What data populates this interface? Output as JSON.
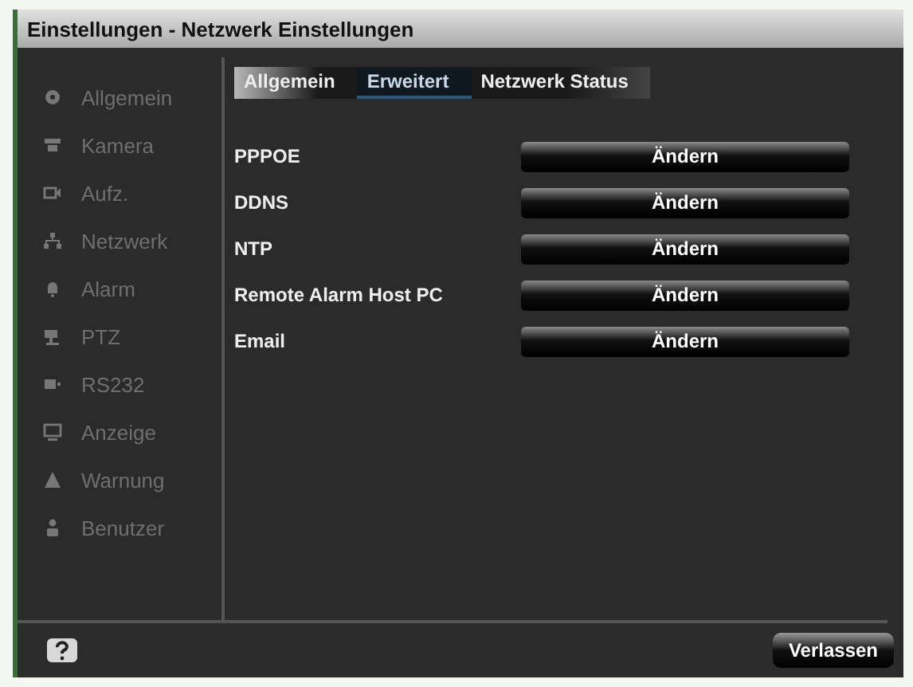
{
  "window": {
    "title": "Einstellungen - Netzwerk Einstellungen"
  },
  "sidebar": {
    "items": [
      {
        "label": "Allgemein"
      },
      {
        "label": "Kamera"
      },
      {
        "label": "Aufz."
      },
      {
        "label": "Netzwerk"
      },
      {
        "label": "Alarm"
      },
      {
        "label": "PTZ"
      },
      {
        "label": "RS232"
      },
      {
        "label": "Anzeige"
      },
      {
        "label": "Warnung"
      },
      {
        "label": "Benutzer"
      }
    ]
  },
  "tabs": [
    {
      "label": "Allgemein",
      "selected": false
    },
    {
      "label": "Erweitert",
      "selected": true
    },
    {
      "label": "Netzwerk Status",
      "selected": false
    }
  ],
  "settings": [
    {
      "label": "PPPOE",
      "button": "Ändern"
    },
    {
      "label": "DDNS",
      "button": "Ändern"
    },
    {
      "label": "NTP",
      "button": "Ändern"
    },
    {
      "label": "Remote Alarm Host PC",
      "button": "Ändern"
    },
    {
      "label": "Email",
      "button": "Ändern"
    }
  ],
  "footer": {
    "exit_button": "Verlassen"
  }
}
